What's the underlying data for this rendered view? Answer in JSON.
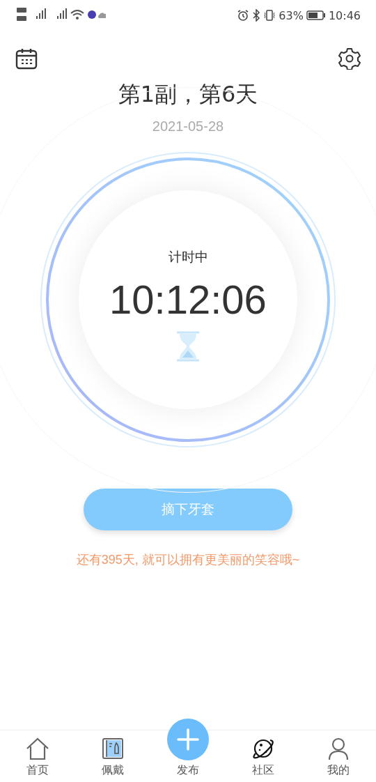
{
  "status_bar": {
    "battery": "63%",
    "time": "10:46"
  },
  "header": {
    "title": "第1副，第6天",
    "date": "2021-05-28"
  },
  "timer": {
    "status": "计时中",
    "elapsed": "10:12:06"
  },
  "action_button": "摘下牙套",
  "message": "还有395天, 就可以拥有更美丽的笑容哦~",
  "nav": [
    {
      "label": "首页",
      "kind": "home"
    },
    {
      "label": "佩戴",
      "kind": "wear"
    },
    {
      "label": "发布",
      "kind": "publish"
    },
    {
      "label": "社区",
      "kind": "planet"
    },
    {
      "label": "我的",
      "kind": "user"
    }
  ]
}
